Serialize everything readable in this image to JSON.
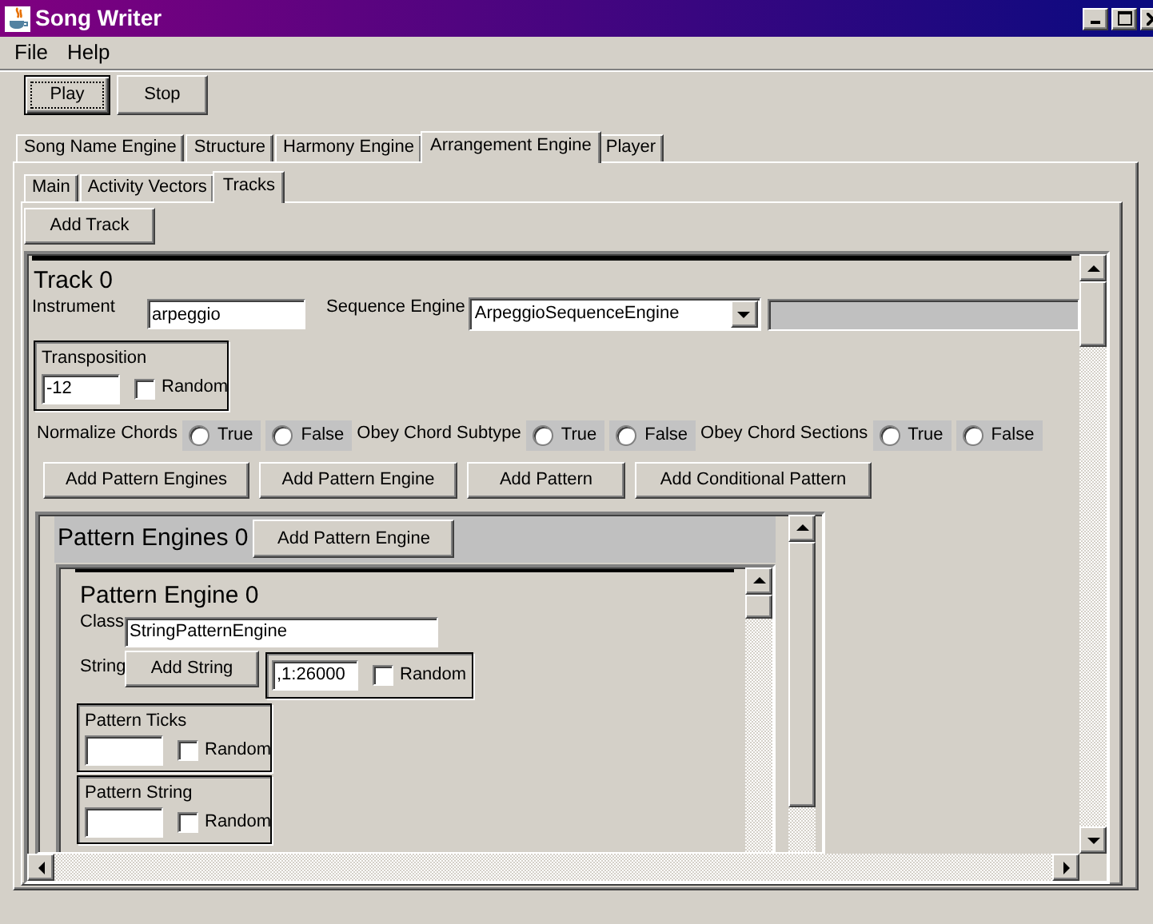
{
  "window": {
    "title": "Song Writer"
  },
  "menu": [
    "File",
    "Help"
  ],
  "toolbar": [
    {
      "label": "Play",
      "focused": true
    },
    {
      "label": "Stop",
      "focused": false
    }
  ],
  "main_tabs": [
    {
      "label": "Song Name Engine",
      "selected": false
    },
    {
      "label": "Structure",
      "selected": false
    },
    {
      "label": "Harmony Engine",
      "selected": false
    },
    {
      "label": "Arrangement Engine",
      "selected": true
    },
    {
      "label": "Player",
      "selected": false
    }
  ],
  "sub_tabs": [
    {
      "label": "Main",
      "selected": false
    },
    {
      "label": "Activity Vectors",
      "selected": false
    },
    {
      "label": "Tracks",
      "selected": true
    }
  ],
  "add_track_button": "Add Track",
  "track": {
    "title": "Track 0",
    "instrument_label": "Instrument",
    "instrument": "arpeggio",
    "sequence_engine_label": "Sequence Engine",
    "sequence_engine": "ArpeggioSequenceEngine",
    "transposition": {
      "label": "Transposition",
      "value": "-12",
      "random_label": "Random",
      "random": false
    },
    "options": [
      {
        "label": "Normalize Chords",
        "choices": [
          {
            "label": "True",
            "selected": false
          },
          {
            "label": "False",
            "selected": false
          }
        ]
      },
      {
        "label": "Obey Chord Subtype",
        "choices": [
          {
            "label": "True",
            "selected": false
          },
          {
            "label": "False",
            "selected": false
          }
        ]
      },
      {
        "label": "Obey Chord Sections",
        "choices": [
          {
            "label": "True",
            "selected": false
          },
          {
            "label": "False",
            "selected": false
          }
        ]
      }
    ],
    "buttons": [
      "Add Pattern Engines",
      "Add Pattern Engine",
      "Add Pattern",
      "Add Conditional Pattern"
    ],
    "pattern_engines": {
      "title": "Pattern Engines 0",
      "add_button": "Add Pattern Engine",
      "engine": {
        "title": "Pattern Engine 0",
        "class_label": "Class",
        "class": "StringPatternEngine",
        "string_label": "String",
        "add_string_button": "Add String",
        "string": {
          "value": ",1:26000",
          "random_label": "Random",
          "random": false
        },
        "fields": [
          {
            "label": "Pattern Ticks",
            "random_label": "Random",
            "random": false
          },
          {
            "label": "Pattern String",
            "random_label": "Random",
            "random": false
          }
        ]
      }
    }
  }
}
